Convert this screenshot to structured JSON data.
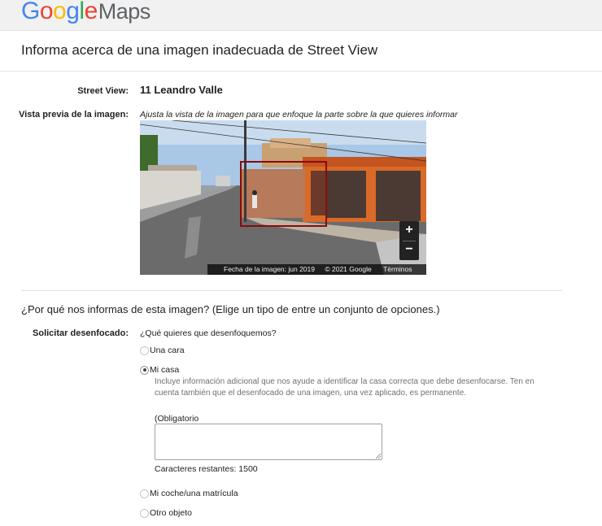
{
  "header": {
    "logo": {
      "letters": [
        "G",
        "o",
        "o",
        "g",
        "l",
        "e"
      ],
      "product": "Maps"
    }
  },
  "page_title": "Informa acerca de una imagen inadecuada de Street View",
  "street_view": {
    "label": "Street View:",
    "value": "11 Leandro Valle"
  },
  "preview": {
    "label": "Vista previa de la imagen:",
    "hint": "Ajusta la vista de la imagen para que enfoque la parte sobre la que quieres informar",
    "footer_date": "Fecha de la imagen: jun 2019",
    "footer_copyright": "© 2021 Google",
    "footer_terms": "Términos",
    "zoom_in": "+",
    "zoom_out": "−"
  },
  "why": {
    "title": "¿Por qué nos informas de esta imagen?  (Elige un tipo de entre un conjunto de opciones.)"
  },
  "blur_request": {
    "label": "Solicitar desenfocado:",
    "question": "¿Qué quieres que desenfoquemos?",
    "options": [
      {
        "label": "Una cara",
        "checked": false
      },
      {
        "label": "Mi casa",
        "checked": true
      },
      {
        "label": "Mi coche/una matrícula",
        "checked": false
      },
      {
        "label": "Otro objeto",
        "checked": false
      }
    ],
    "help_text": "Incluye información adicional que nos ayude a identificar la casa correcta que debe desenfocarse. Ten en cuenta también que el desenfocado de una imagen, una vez aplicado, es permanente.",
    "required_label": "(Obligatorio",
    "textarea_value": "",
    "chars_remaining": "Caracteres restantes: 1500"
  },
  "colors": {
    "google_blue": "#4285f4",
    "google_red": "#ea4335",
    "google_yellow": "#fbbc05",
    "google_green": "#34a853",
    "focus_box": "#8b0a0a"
  }
}
